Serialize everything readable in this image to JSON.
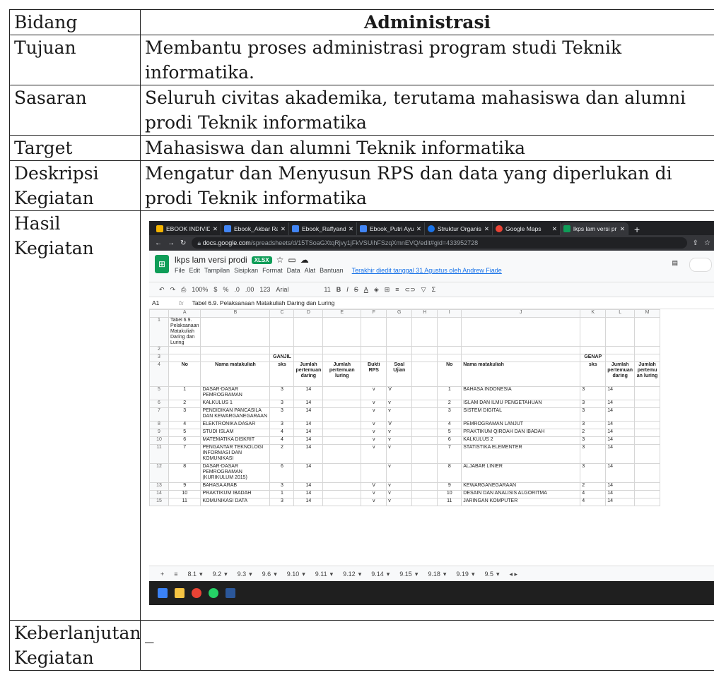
{
  "doc": {
    "header": {
      "label": "Bidang",
      "value": "Administrasi"
    },
    "rows": [
      {
        "label": "Tujuan",
        "value": "Membantu proses administrasi program studi Teknik informatika."
      },
      {
        "label": "Sasaran",
        "value": "Seluruh civitas akademika, terutama mahasiswa dan alumni prodi Teknik informatika"
      },
      {
        "label": "Target",
        "value": "Mahasiswa dan alumni Teknik informatika"
      },
      {
        "label": "Deskripsi Kegiatan",
        "value": "Mengatur dan Menyusun RPS dan data yang diperlukan di prodi Teknik informatika"
      }
    ],
    "hasil_label": "Hasil Kegiatan",
    "lanjut_label": "Keberlanjutan Kegiatan",
    "lanjut_value": "_"
  },
  "screenshot": {
    "tabs": [
      "EBOOK INDIVIDU",
      "Ebook_Akbar Ral",
      "Ebook_Raffyanda",
      "Ebook_Putri Ayu",
      "Struktur Organis",
      "Google Maps",
      "lkps lam versi pr"
    ],
    "url_host": "docs.google.com",
    "url_rest": "/spreadsheets/d/15TSoaGXtqRjvy1jFkVSUihFSzqXmnEVQ/edit#gid=433952728",
    "file_title": "lkps lam versi prodi",
    "file_badge": "XLSX",
    "menus": [
      "File",
      "Edit",
      "Tampilan",
      "Sisipkan",
      "Format",
      "Data",
      "Alat",
      "Bantuan"
    ],
    "last_edit": "Terakhir diedit tanggal 31 Agustus oleh Andrew Fiade",
    "toolbar": {
      "zoom": "100%",
      "currency": "$",
      "percent": "%",
      "dec1": ".0",
      "dec2": ".00",
      "fmt": "123",
      "font": "Arial",
      "size": "11"
    },
    "cell_ref": "A1",
    "formula": "Tabel 6.9. Pelaksanaan Matakuliah Daring dan Luring",
    "col_letters": [
      "A",
      "B",
      "C",
      "D",
      "E",
      "F",
      "G",
      "H",
      "I",
      "J",
      "K",
      "L",
      "M"
    ],
    "ganjil": "GANJIL",
    "genap": "GENAP",
    "headers_left": [
      "No",
      "Nama matakuliah",
      "sks",
      "Jumlah pertemuan daring",
      "Jumlah pertemuan luring",
      "Bukti RPS",
      "Soal Ujian"
    ],
    "headers_right": [
      "No",
      "Nama matakuliah",
      "sks",
      "Jumlah pertemuan daring",
      "Jumlah pertemu an luring"
    ],
    "left_rows": [
      [
        "1",
        "DASAR-DASAR PEMROGRAMAN",
        "3",
        "14",
        "v",
        "V"
      ],
      [
        "2",
        "KALKULUS 1",
        "3",
        "14",
        "v",
        "v"
      ],
      [
        "3",
        "PENDIDIKAN PANCASILA DAN KEWARGANEGARAAN",
        "3",
        "14",
        "v",
        "v"
      ],
      [
        "4",
        "ELEKTRONIKA DASAR",
        "3",
        "14",
        "v",
        "V"
      ],
      [
        "5",
        "STUDI ISLAM",
        "4",
        "14",
        "v",
        "v"
      ],
      [
        "6",
        "MATEMATIKA DISKRIT",
        "4",
        "14",
        "v",
        "v"
      ],
      [
        "7",
        "PENGANTAR TEKNOLOGI INFORMASI DAN KOMUNIKASI",
        "2",
        "14",
        "v",
        "v"
      ],
      [
        "8",
        "DASAR-DASAR PEMROGRAMAN (KURIKULUM 2015)",
        "6",
        "14",
        "",
        "v"
      ],
      [
        "9",
        "BAHASA ARAB",
        "3",
        "14",
        "V",
        "v"
      ],
      [
        "10",
        "PRAKTIKUM IBADAH",
        "1",
        "14",
        "v",
        "v"
      ],
      [
        "11",
        "KOMUNIKASI DATA",
        "3",
        "14",
        "v",
        "v"
      ]
    ],
    "right_rows": [
      [
        "1",
        "BAHASA INDONESIA",
        "3",
        "14"
      ],
      [
        "2",
        "ISLAM DAN ILMU PENGETAHUAN",
        "3",
        "14"
      ],
      [
        "3",
        "SISTEM DIGITAL",
        "3",
        "14"
      ],
      [
        "4",
        "PEMROGRAMAN LANJUT",
        "3",
        "14"
      ],
      [
        "5",
        "PRAKTIKUM QIROAH DAN IBADAH",
        "2",
        "14"
      ],
      [
        "6",
        "KALKULUS 2",
        "3",
        "14"
      ],
      [
        "7",
        "STATISTIKA ELEMENTER",
        "3",
        "14"
      ],
      [
        "8",
        "ALJABAR LINIER",
        "3",
        "14"
      ],
      [
        "9",
        "KEWARGANEGARAAN",
        "2",
        "14"
      ],
      [
        "10",
        "DESAIN DAN ANALISIS ALGORITMA",
        "4",
        "14"
      ],
      [
        "11",
        "JARINGAN KOMPUTER",
        "4",
        "14"
      ]
    ],
    "sheets": [
      "8.1",
      "9.2",
      "9.3",
      "9.6",
      "9.10",
      "9.11",
      "9.12",
      "9.14",
      "9.15",
      "9.18",
      "9.19",
      "9.5"
    ]
  }
}
